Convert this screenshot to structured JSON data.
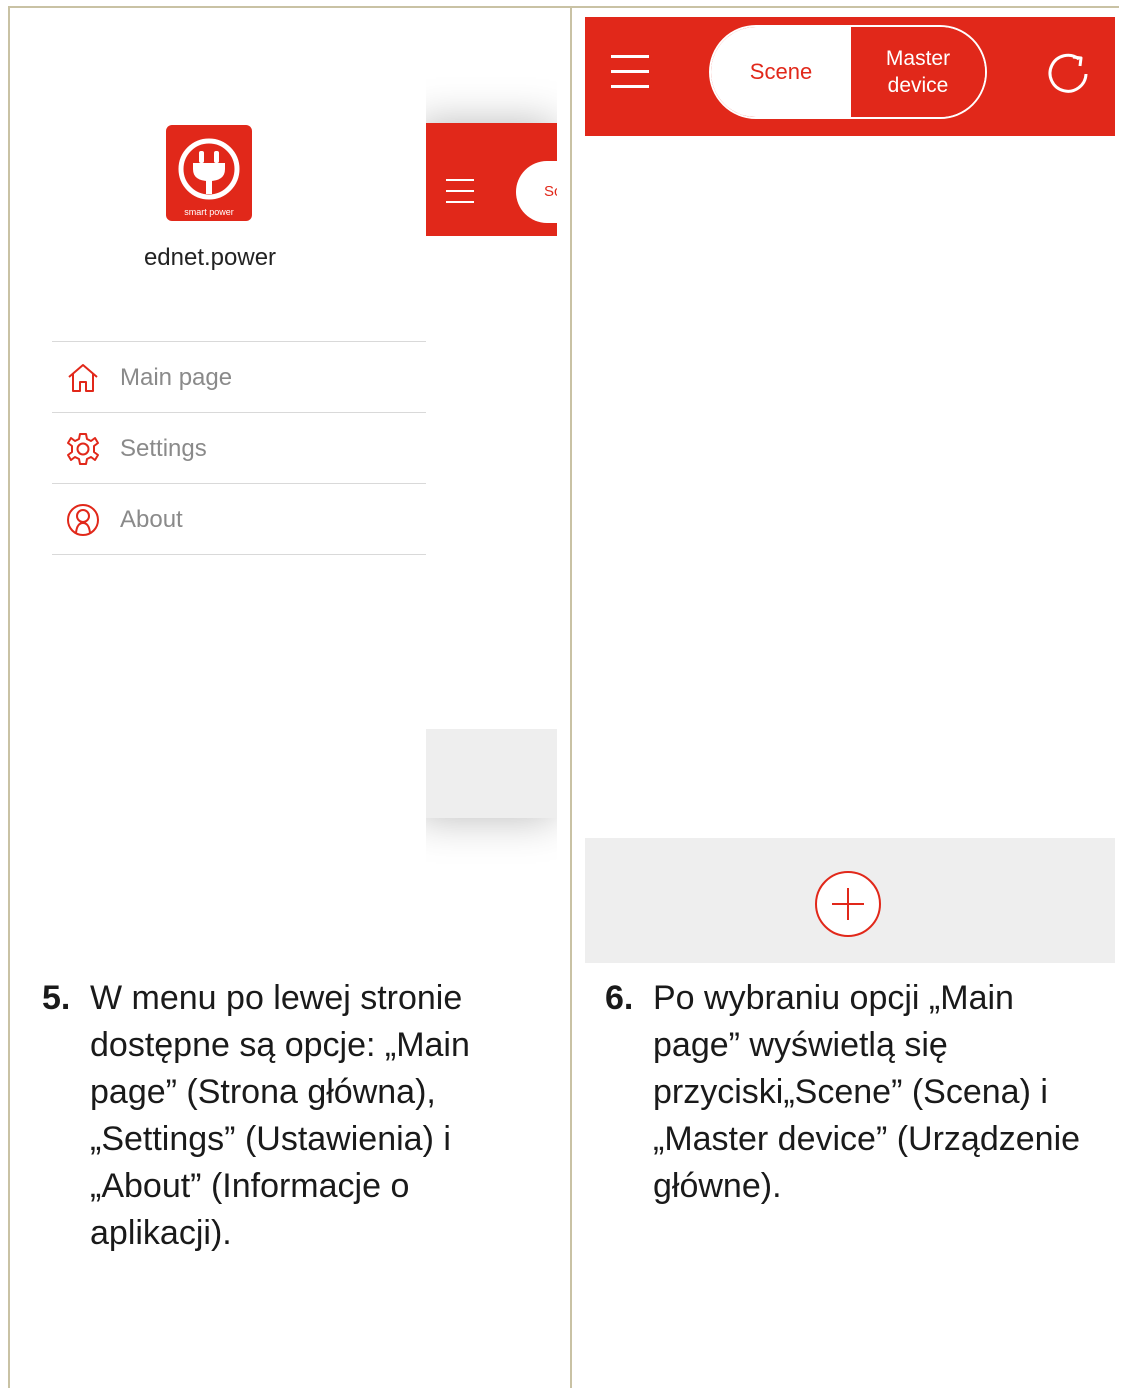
{
  "left_panel": {
    "logo_caption": "smart power",
    "app_name": "ednet.power",
    "behind_tab_partial": "Sc",
    "menu": [
      {
        "label": "Main page",
        "icon": "home-icon"
      },
      {
        "label": "Settings",
        "icon": "gear-icon"
      },
      {
        "label": "About",
        "icon": "user-info-icon"
      }
    ]
  },
  "right_panel": {
    "tabs": {
      "scene": "Scene",
      "master": "Master\ndevice"
    },
    "icons": {
      "menu": "hamburger-icon",
      "refresh": "refresh-icon",
      "add": "plus-icon"
    }
  },
  "captions": [
    {
      "number": "5.",
      "text": "W menu po lewej stronie dostępne są opcje: „Main page” (Strona główna), „Settings” (Ustawienia) i „About” (Informacje o aplikacji)."
    },
    {
      "number": "6.",
      "text": "Po wybraniu opcji „Main page” wyświetlą się przyciski„Scene” (Scena) i „Master device” (Urządzenie główne)."
    }
  ],
  "colors": {
    "brand_red": "#e1281a",
    "frame": "#c9c2a4",
    "footer_gray": "#eeeeee"
  }
}
